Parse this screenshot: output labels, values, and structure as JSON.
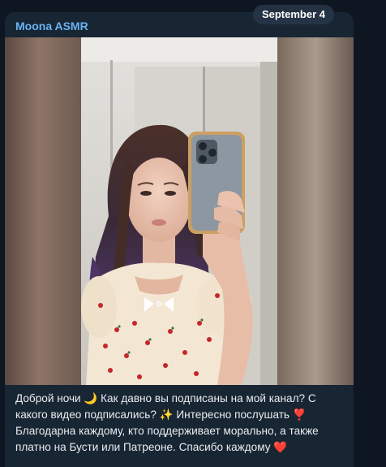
{
  "date_pill": "September 4",
  "message": {
    "sender": "Moona ASMR",
    "caption": "Доброй ночи 🌙 Как давно вы подписаны на мой канал? С какого видео подписались? ✨ Интересно послушать ❣️ Благодарна каждому, кто поддерживает морально, а также платно на Бусти или Патреоне. Спасибо каждому ❤️"
  },
  "colors": {
    "background": "#0e1621",
    "bubble": "#182533",
    "sender_name": "#6ab3f3",
    "text": "#e9edf1"
  }
}
